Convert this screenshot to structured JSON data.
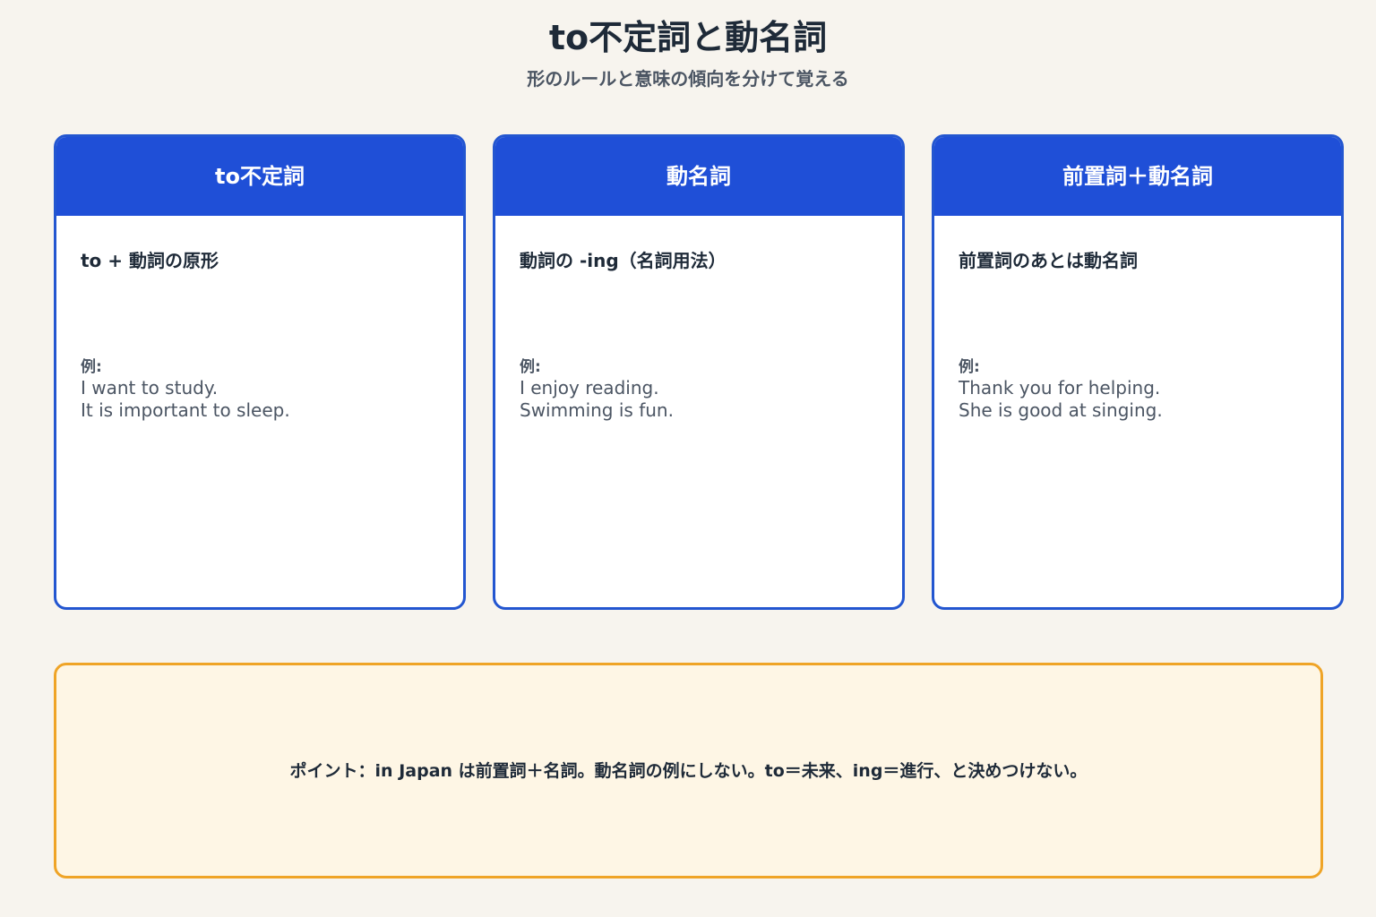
{
  "header": {
    "title": "to不定詞と動名詞",
    "subtitle": "形のルールと意味の傾向を分けて覚える"
  },
  "cards": [
    {
      "title": "to不定詞",
      "rule": "to + 動詞の原形",
      "example_label": "例:",
      "examples": [
        "I want to study.",
        "It is important to sleep."
      ]
    },
    {
      "title": "動名詞",
      "rule": "動詞の -ing（名詞用法）",
      "example_label": "例:",
      "examples": [
        "I enjoy reading.",
        "Swimming is fun."
      ]
    },
    {
      "title": "前置詞＋動名詞",
      "rule": "前置詞のあとは動名詞",
      "example_label": "例:",
      "examples": [
        "Thank you for helping.",
        "She is good at singing."
      ]
    }
  ],
  "note": {
    "text": "ポイント：in Japan は前置詞＋名詞。動名詞の例にしない。to＝未来、ing＝進行、と決めつけない。"
  }
}
